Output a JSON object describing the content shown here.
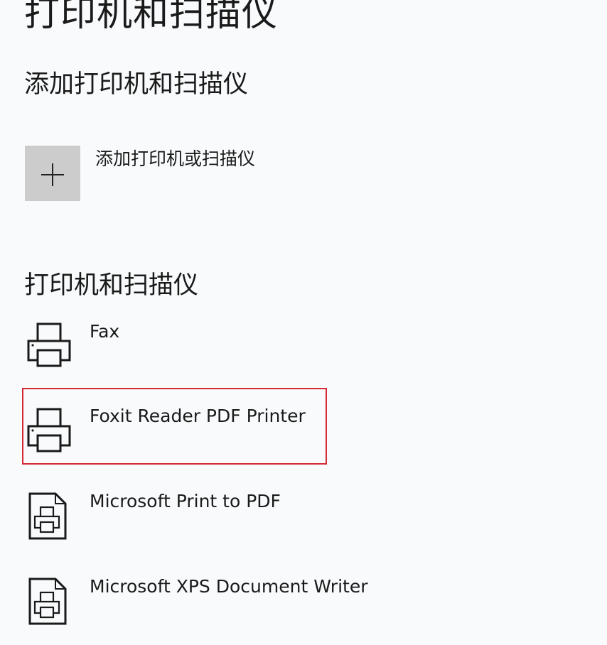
{
  "page": {
    "title": "打印机和扫描仪"
  },
  "add_section": {
    "heading": "添加打印机和扫描仪",
    "button_label": "添加打印机或扫描仪",
    "button_icon": "plus-icon"
  },
  "devices_section": {
    "heading": "打印机和扫描仪",
    "items": [
      {
        "label": "Fax",
        "icon": "printer-icon"
      },
      {
        "label": "Foxit Reader PDF Printer",
        "icon": "printer-icon",
        "highlighted": true
      },
      {
        "label": "Microsoft Print to PDF",
        "icon": "document-printer-icon"
      },
      {
        "label": "Microsoft XPS Document Writer",
        "icon": "document-printer-icon"
      }
    ]
  },
  "colors": {
    "background": "#f9fafb",
    "tile": "#cccccc",
    "highlight": "#d42a35"
  }
}
